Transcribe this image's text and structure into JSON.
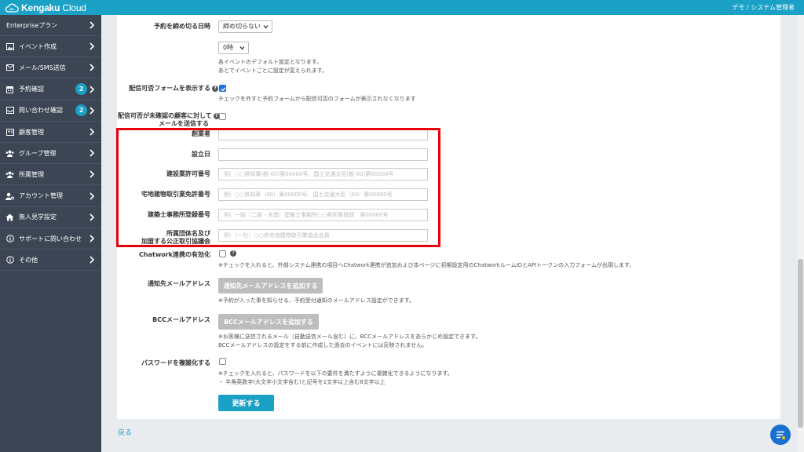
{
  "header": {
    "logo_text_bold": "Kengaku",
    "logo_text_light": " Cloud",
    "user": "デモ / システム管理者"
  },
  "sidebar": {
    "items": [
      {
        "label": "Enterpriseプラン",
        "icon": "none"
      },
      {
        "label": "イベント作成",
        "icon": "image-icon"
      },
      {
        "label": "メール/SMS送信",
        "icon": "mail-icon"
      },
      {
        "label": "予約確認",
        "icon": "calendar-icon",
        "badge": "2"
      },
      {
        "label": "問い合わせ確認",
        "icon": "inbox-icon",
        "badge": "2"
      },
      {
        "label": "顧客管理",
        "icon": "address-card-icon"
      },
      {
        "label": "グループ管理",
        "icon": "users-icon"
      },
      {
        "label": "所属管理",
        "icon": "users-icon"
      },
      {
        "label": "アカウント管理",
        "icon": "user-cog-icon"
      },
      {
        "label": "無人見学設定",
        "icon": "home-icon"
      },
      {
        "label": "サポートに問い合わせ",
        "icon": "info-icon"
      },
      {
        "label": "その他",
        "icon": "info-icon"
      }
    ]
  },
  "form": {
    "deadline_label": "予約を締め切る日時",
    "deadline_select": "締め切らない",
    "hour_select": "0時",
    "deadline_help_1": "各イベントのデフォルト設定となります。",
    "deadline_help_2": "あとでイベントごとに設定が変えられます。",
    "optout_label": "配信可否フォームを表示する",
    "optout_help": "チェックを外すと予約フォームから配信可否のフォームが表示されなくなります",
    "unconfirmed_label_1": "配信可否が未確認の顧客に対して",
    "unconfirmed_label_2": "メールを送信する",
    "founder_label": "創業者",
    "founded_label": "設立日",
    "construction_license_label": "建設業許可番号",
    "construction_license_placeholder": "例）○○県知事(般-00)第00000号、国土交通大臣(般-00)第00000号",
    "realestate_license_label": "宅地建物取引業免許番号",
    "realestate_license_placeholder": "例）○○県知事（00）第00000号、国土交通大臣（00）第00000号",
    "architect_label": "建築士事務所登録番号",
    "architect_placeholder": "例）一級（二級・木造）建築士事務所○○県知事登録　第00000号",
    "association_label_1": "所属団体名及び",
    "association_label_2": "加盟する公正取引協議会",
    "association_placeholder": "例）（一社）○○県宅地建物取引業協会会員",
    "chatwork_label": "Chatwork連携の有効化",
    "chatwork_help": "※チェックを入れると、外部システム連携の項目へChatwork連携が追加および本ページに初期設定用のChatworkルームIDとAPIトークンの入力フォームが出現します。",
    "notify_label": "通知先メールアドレス",
    "notify_button": "通知先メールアドレスを追加する",
    "notify_help": "※予約が入った事を知らせる、予約受付通知のメールアドレス設定ができます。",
    "bcc_label": "BCCメールアドレス",
    "bcc_button": "BCCメールアドレスを追加する",
    "bcc_help_1": "※お客様に送信されるメール（自動送信メール含む）に、BCCメールアドレスをあらかじめ設定できます。",
    "bcc_help_2": "BCCメールアドレスの設定をする前に作成した過去のイベントには反映されません。",
    "password_label": "パスワードを複雑化する",
    "password_help_1": "※チェックを入れると、パスワードを以下の要件を満たすように複雑化できるようになります。",
    "password_help_2": "・ 半角英数字(大文字小文字含む)と記号を1文字以上含む8文字以上",
    "update_button": "更新する",
    "back_link": "戻る"
  },
  "state": {
    "optout_checked": true,
    "unconfirmed_checked": false,
    "chatwork_checked": false,
    "password_checked": false
  },
  "colors": {
    "accent": "#1ba1c6",
    "sidebar": "#3c4553",
    "highlight": "#e8000b",
    "fab": "#1a6fd0"
  }
}
